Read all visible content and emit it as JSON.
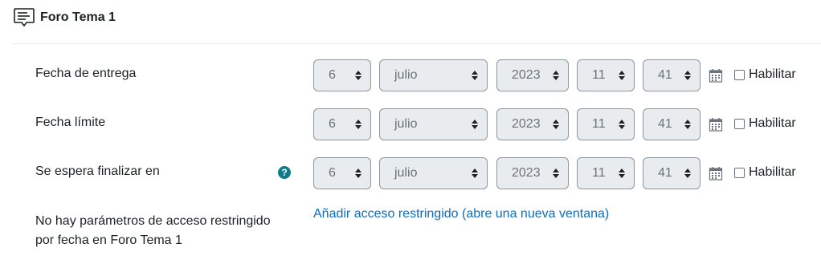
{
  "header": {
    "title": "Foro Tema 1",
    "icon": "forum-icon"
  },
  "rows": [
    {
      "label": "Fecha de entrega",
      "day": "6",
      "month": "julio",
      "year": "2023",
      "hour": "11",
      "minute": "41",
      "enable_label": "Habilitar",
      "enabled": false,
      "help": false
    },
    {
      "label": "Fecha límite",
      "day": "6",
      "month": "julio",
      "year": "2023",
      "hour": "11",
      "minute": "41",
      "enable_label": "Habilitar",
      "enabled": false,
      "help": false
    },
    {
      "label": "Se espera finalizar en",
      "day": "6",
      "month": "julio",
      "year": "2023",
      "hour": "11",
      "minute": "41",
      "enable_label": "Habilitar",
      "enabled": false,
      "help": true
    }
  ],
  "restrict": {
    "note": "No hay parámetros de acceso restringido por fecha en Foro Tema 1",
    "link": "Añadir acceso restringido (abre una nueva ventana)"
  },
  "colors": {
    "link": "#0f6cbf",
    "help": "#0f7d87",
    "select_bg": "#e9ecef"
  }
}
